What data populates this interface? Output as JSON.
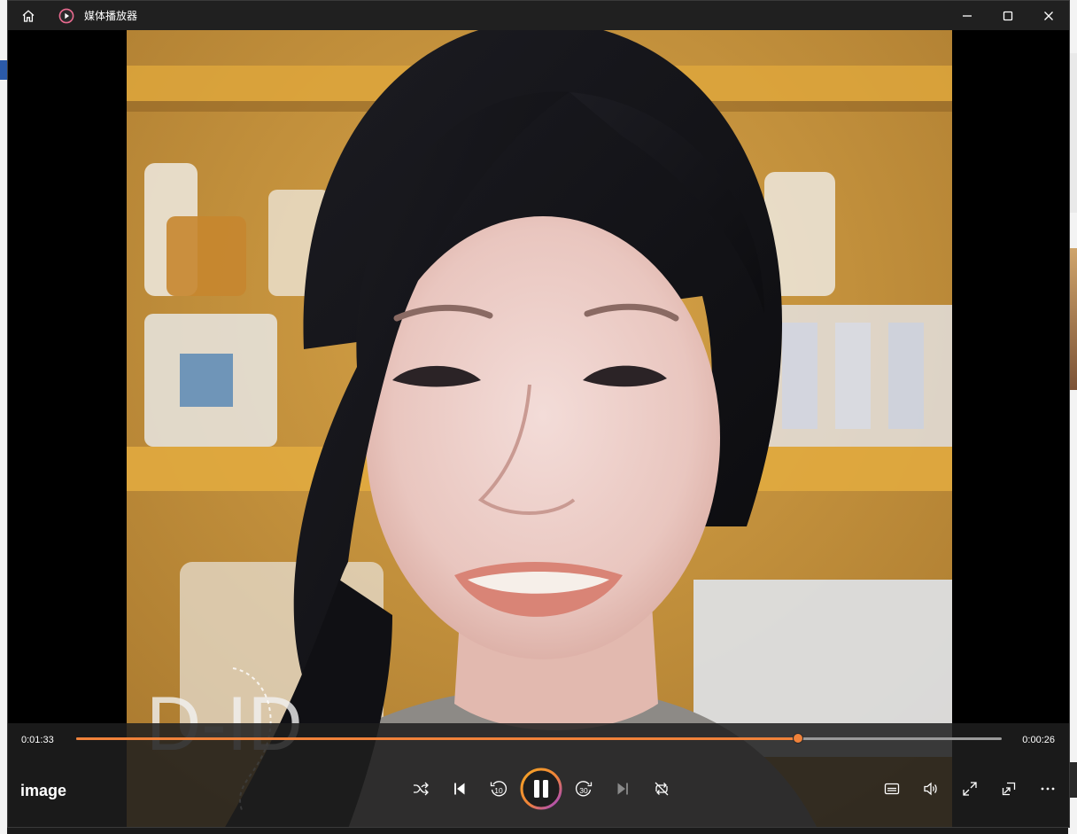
{
  "window": {
    "title": "媒体播放器"
  },
  "player": {
    "media_title": "image",
    "elapsed": "0:01:33",
    "remaining": "0:00:26",
    "progress_percent": 78,
    "skip_back_seconds": "10",
    "skip_forward_seconds": "30",
    "state": "playing",
    "accent_color": "#f0823a"
  },
  "video": {
    "watermark": "D-ID"
  },
  "icons": {
    "titlebar": [
      "home-icon",
      "media-player-app-icon",
      "minimize-icon",
      "maximize-icon",
      "close-icon"
    ],
    "transport": [
      "shuffle-icon",
      "previous-icon",
      "skip-back-10-icon",
      "pause-icon",
      "skip-forward-30-icon",
      "next-icon",
      "repeat-off-icon"
    ],
    "right": [
      "captions-icon",
      "volume-icon",
      "fullscreen-icon",
      "mini-player-icon",
      "more-icon"
    ]
  }
}
